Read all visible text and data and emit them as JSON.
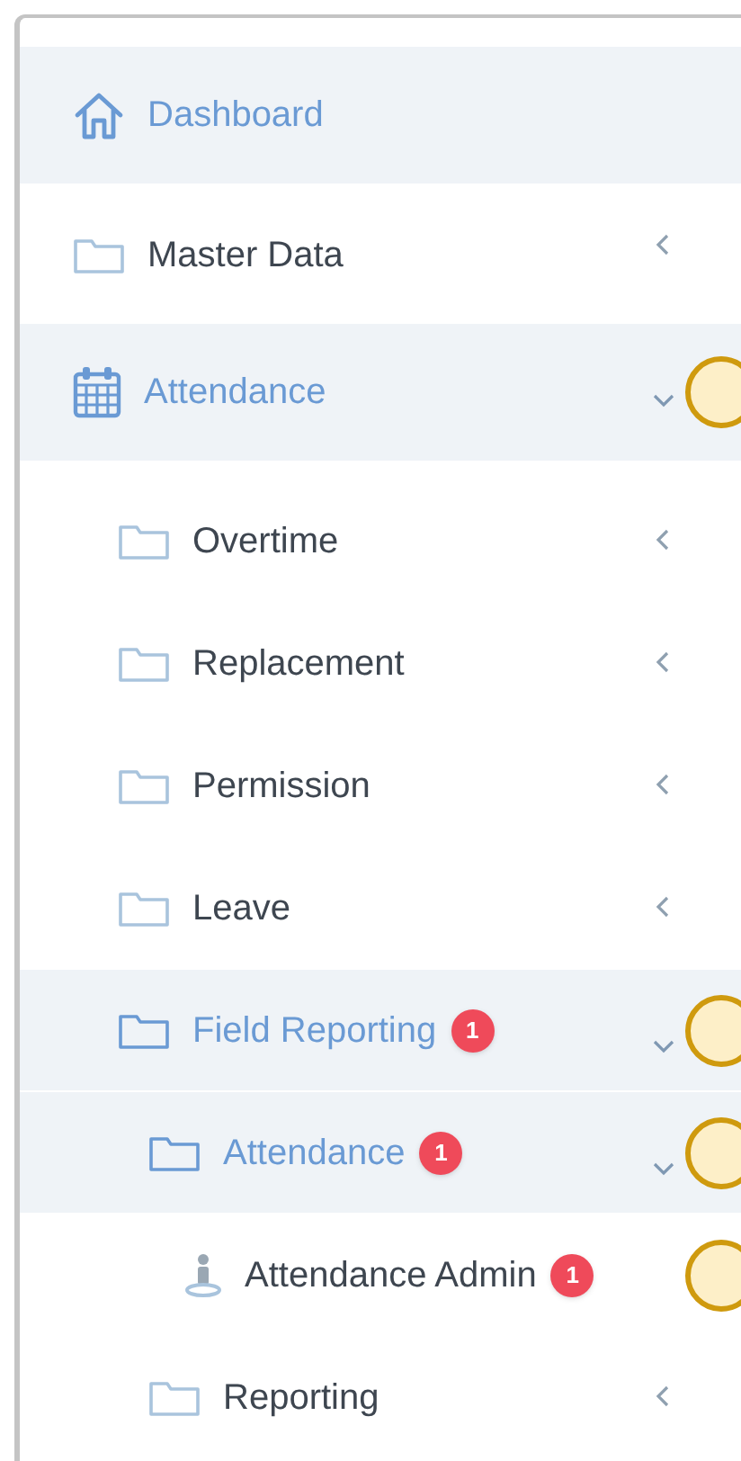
{
  "menu": {
    "items": [
      {
        "label": "Dashboard",
        "kind": "home",
        "selected": true,
        "marked": false
      },
      {
        "label": "Master Data",
        "kind": "folder",
        "selected": false,
        "expanded": false,
        "marked": false
      },
      {
        "label": "Attendance",
        "kind": "calendar",
        "selected": true,
        "expanded": true,
        "marked": true,
        "children": [
          {
            "label": "Overtime",
            "kind": "folder",
            "selected": false,
            "expanded": false,
            "marked": false
          },
          {
            "label": "Replacement",
            "kind": "folder",
            "selected": false,
            "expanded": false,
            "marked": false
          },
          {
            "label": "Permission",
            "kind": "folder",
            "selected": false,
            "expanded": false,
            "marked": false
          },
          {
            "label": "Leave",
            "kind": "folder",
            "selected": false,
            "expanded": false,
            "marked": false
          },
          {
            "label": "Field Reporting",
            "kind": "folder",
            "selected": true,
            "expanded": true,
            "badge": "1",
            "marked": true,
            "children": [
              {
                "label": "Attendance",
                "kind": "folder",
                "selected": true,
                "expanded": true,
                "badge": "1",
                "marked": true,
                "children": [
                  {
                    "label": "Attendance Admin",
                    "kind": "person",
                    "selected": false,
                    "badge": "1",
                    "marked": true
                  }
                ]
              },
              {
                "label": "Reporting",
                "kind": "folder",
                "selected": false,
                "expanded": false,
                "marked": false
              }
            ]
          }
        ]
      }
    ]
  }
}
